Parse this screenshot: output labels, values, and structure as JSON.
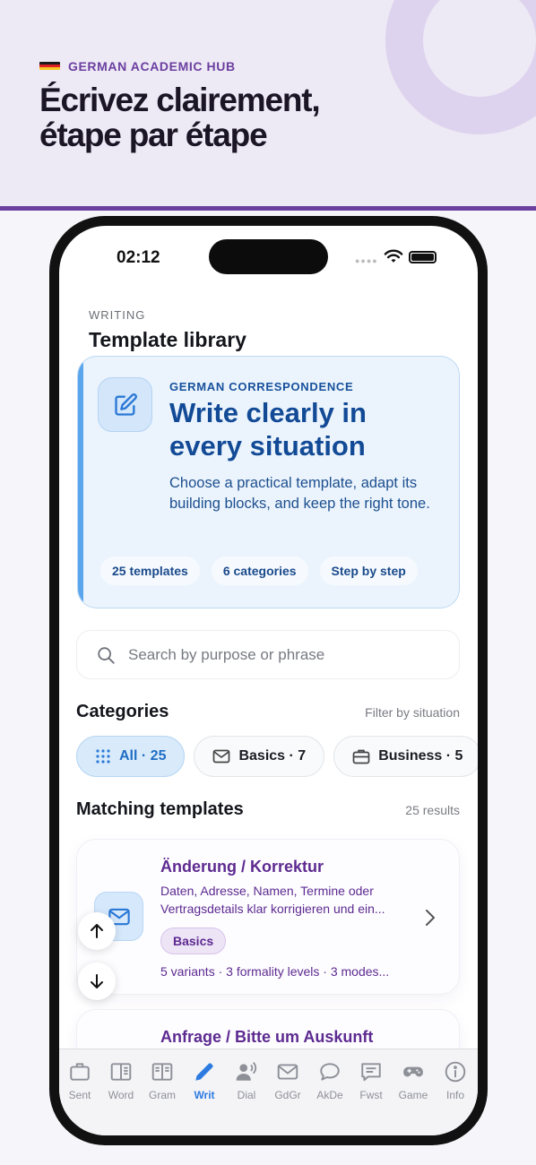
{
  "hero": {
    "kicker": "GERMAN ACADEMIC HUB",
    "title_line1": "Écrivez clairement,",
    "title_line2": "étape par étape",
    "accent_color": "#6b3fa0"
  },
  "status_bar": {
    "time": "02:12"
  },
  "header": {
    "section": "WRITING",
    "title": "Template library"
  },
  "feature_card": {
    "kicker": "GERMAN CORRESPONDENCE",
    "title": "Write clearly in every situation",
    "description": "Choose a practical template, adapt its building blocks, and keep the right tone.",
    "icon": "edit-square-icon",
    "pills": [
      "25 templates",
      "6 categories",
      "Step by step"
    ]
  },
  "search": {
    "placeholder": "Search by purpose or phrase",
    "value": ""
  },
  "categories": {
    "title": "Categories",
    "hint": "Filter by situation",
    "chips": [
      {
        "label": "All · 25",
        "icon": "grid-icon",
        "active": true
      },
      {
        "label": "Basics · 7",
        "icon": "envelope-icon",
        "active": false
      },
      {
        "label": "Business · 5",
        "icon": "briefcase-icon",
        "active": false
      }
    ]
  },
  "templates": {
    "title": "Matching templates",
    "count": "25 results",
    "items": [
      {
        "title": "Änderung / Korrektur",
        "description": "Daten, Adresse, Namen, Termine oder Vertragsdetails klar korrigieren und ein...",
        "tag": "Basics",
        "meta": "5 variants · 3 formality levels · 3 modes...",
        "icon": "envelope-icon"
      },
      {
        "title": "Anfrage / Bitte um Auskunft",
        "description": "",
        "tag": "",
        "meta": "",
        "icon": "envelope-icon"
      }
    ]
  },
  "tabbar": {
    "items": [
      {
        "label": "Sent",
        "icon": "suitcase-icon",
        "active": false
      },
      {
        "label": "Word",
        "icon": "book-icon",
        "active": false
      },
      {
        "label": "Gram",
        "icon": "book-open-icon",
        "active": false
      },
      {
        "label": "Writ",
        "icon": "pencil-icon",
        "active": true
      },
      {
        "label": "Dial",
        "icon": "person-speaking-icon",
        "active": false
      },
      {
        "label": "GdGr",
        "icon": "envelope-icon",
        "active": false
      },
      {
        "label": "AkDe",
        "icon": "chat-bubble-icon",
        "active": false
      },
      {
        "label": "Fwst",
        "icon": "text-message-icon",
        "active": false
      },
      {
        "label": "Game",
        "icon": "gamepad-icon",
        "active": false
      },
      {
        "label": "Info",
        "icon": "info-icon",
        "active": false
      }
    ]
  }
}
